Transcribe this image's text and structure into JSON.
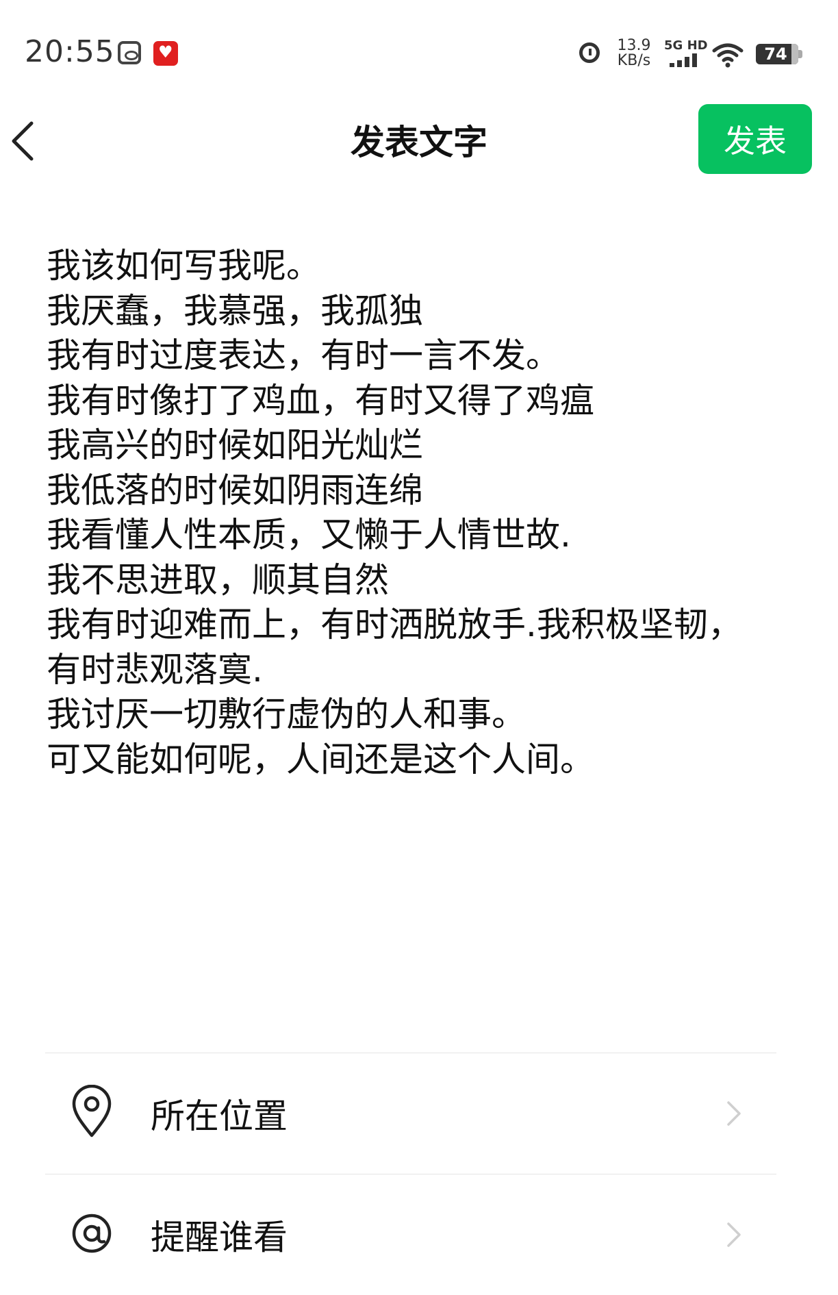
{
  "status_bar": {
    "time": "20:55",
    "net_speed_value": "13.9",
    "net_speed_unit": "KB/s",
    "network_type": "5G HD",
    "battery": "74"
  },
  "header": {
    "title": "发表文字",
    "publish_label": "发表"
  },
  "post": {
    "lines": [
      "我该如何写我呢。",
      "我厌蠢，我慕强，我孤独",
      "我有时过度表达，有时一言不发。",
      "我有时像打了鸡血，有时又得了鸡瘟",
      "我高兴的时候如阳光灿烂",
      "我低落的时候如阴雨连绵",
      "我看懂人性本质，又懒于人情世故.",
      "我不思进取，顺其自然",
      "我有时迎难而上，有时洒脱放手.我积极坚韧，",
      "有时悲观落寞.",
      "我讨厌一切敷行虚伪的人和事。",
      "可又能如何呢，人间还是这个人间。"
    ]
  },
  "options": {
    "location_label": "所在位置",
    "remind_label": "提醒谁看"
  },
  "colors": {
    "accent": "#07c160",
    "text": "#111111",
    "divider": "#e6e6e6"
  }
}
